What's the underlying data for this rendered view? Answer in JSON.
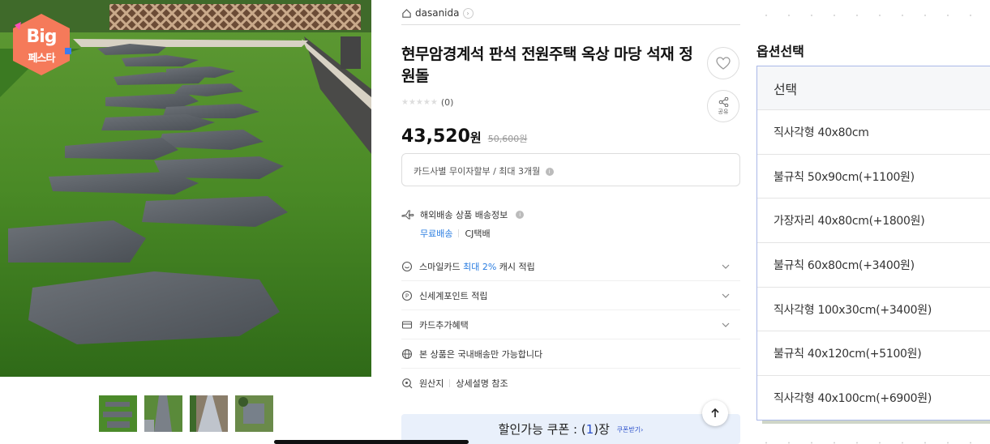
{
  "gallery": {
    "badge_line1": "Big",
    "badge_line2": "페스타",
    "thumbnails": [
      "thumb-1",
      "thumb-2",
      "thumb-3",
      "thumb-4"
    ]
  },
  "product": {
    "brand": "dasanida",
    "title": "현무암경계석 판석 전원주택 옥상 마당 석재 정원돌",
    "rating_count": "(0)",
    "price": "43,520",
    "price_unit": "원",
    "original_price": "50,600원",
    "installment": "카드사별 무이자할부 / 최대 3개월",
    "share_label": "공유",
    "shipping": {
      "label": "해외배송 상품 배송정보",
      "free": "무료배송",
      "carrier": "CJ택배"
    },
    "benefits": [
      {
        "prefix": "스마일카드 ",
        "highlight": "최대 2%",
        "suffix": " 캐시 적립"
      },
      {
        "prefix": "신세계포인트 적립",
        "highlight": "",
        "suffix": ""
      },
      {
        "prefix": "카드추가혜택",
        "highlight": "",
        "suffix": ""
      }
    ],
    "domestic_only": "본 상품은 국내배송만 가능합니다",
    "origin_label": "원산지",
    "origin_value": "상세설명 참조",
    "coupon": {
      "prefix": "할인가능 쿠폰 : (",
      "count": "1",
      "suffix": ")장",
      "link": "쿠폰받기›"
    }
  },
  "options": {
    "title": "옵션선택",
    "placeholder": "선택",
    "items": [
      "직사각형 40x80cm",
      "불규칙 50x90cm(+1100원)",
      "가장자리 40x80cm(+1800원)",
      "불규칙 60x80cm(+3400원)",
      "직사각형 100x30cm(+3400원)",
      "불규칙 40x120cm(+5100원)",
      "직사각형 40x100cm(+6900원)"
    ]
  },
  "colors": {
    "accent": "#2a7de1",
    "coupon_bg": "#e9f0fb",
    "option_border": "#aab8e8"
  }
}
